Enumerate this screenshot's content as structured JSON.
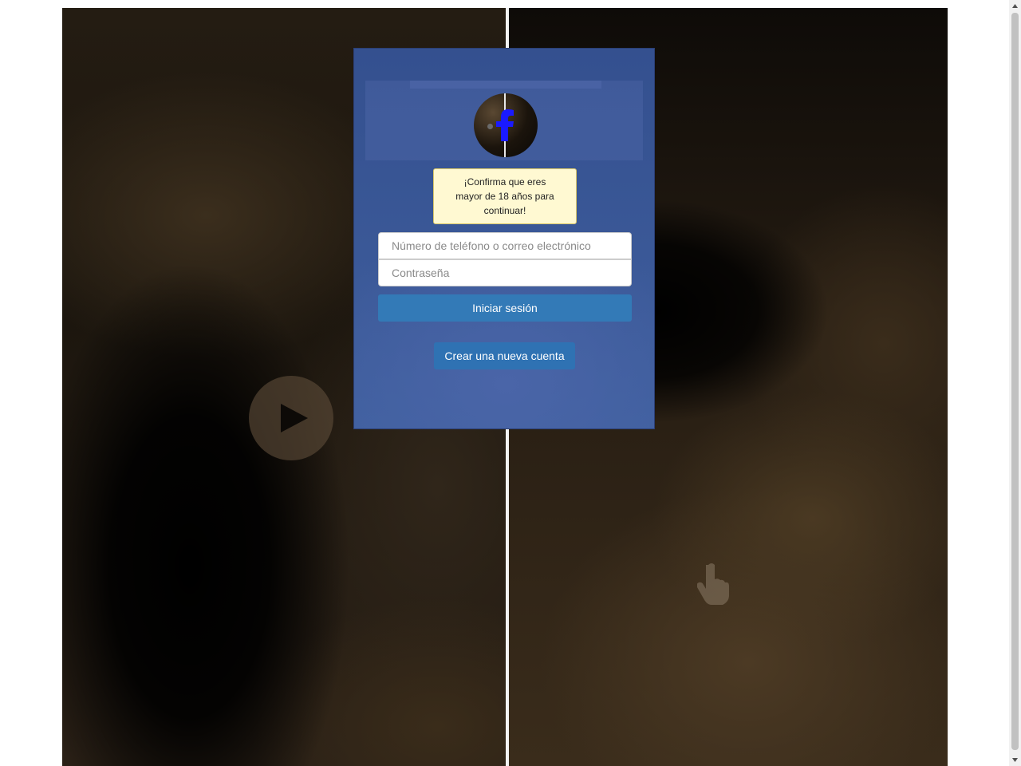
{
  "notice": {
    "text": "¡Confirma que eres mayor de 18 años para continuar!"
  },
  "login_form": {
    "phone_placeholder": "Número de teléfono o correo electrónico",
    "password_placeholder": "Contraseña",
    "login_label": "Iniciar sesión",
    "create_account_label": "Crear una nueva cuenta"
  },
  "icons": {
    "logo": "facebook-f-icon",
    "play": "play-icon",
    "cursor": "hand-cursor-icon"
  },
  "colors": {
    "modal_bg": "#3b5998",
    "primary_button": "#337ab7",
    "notice_bg": "#fff9d2",
    "logo_f": "#1a1aff"
  }
}
